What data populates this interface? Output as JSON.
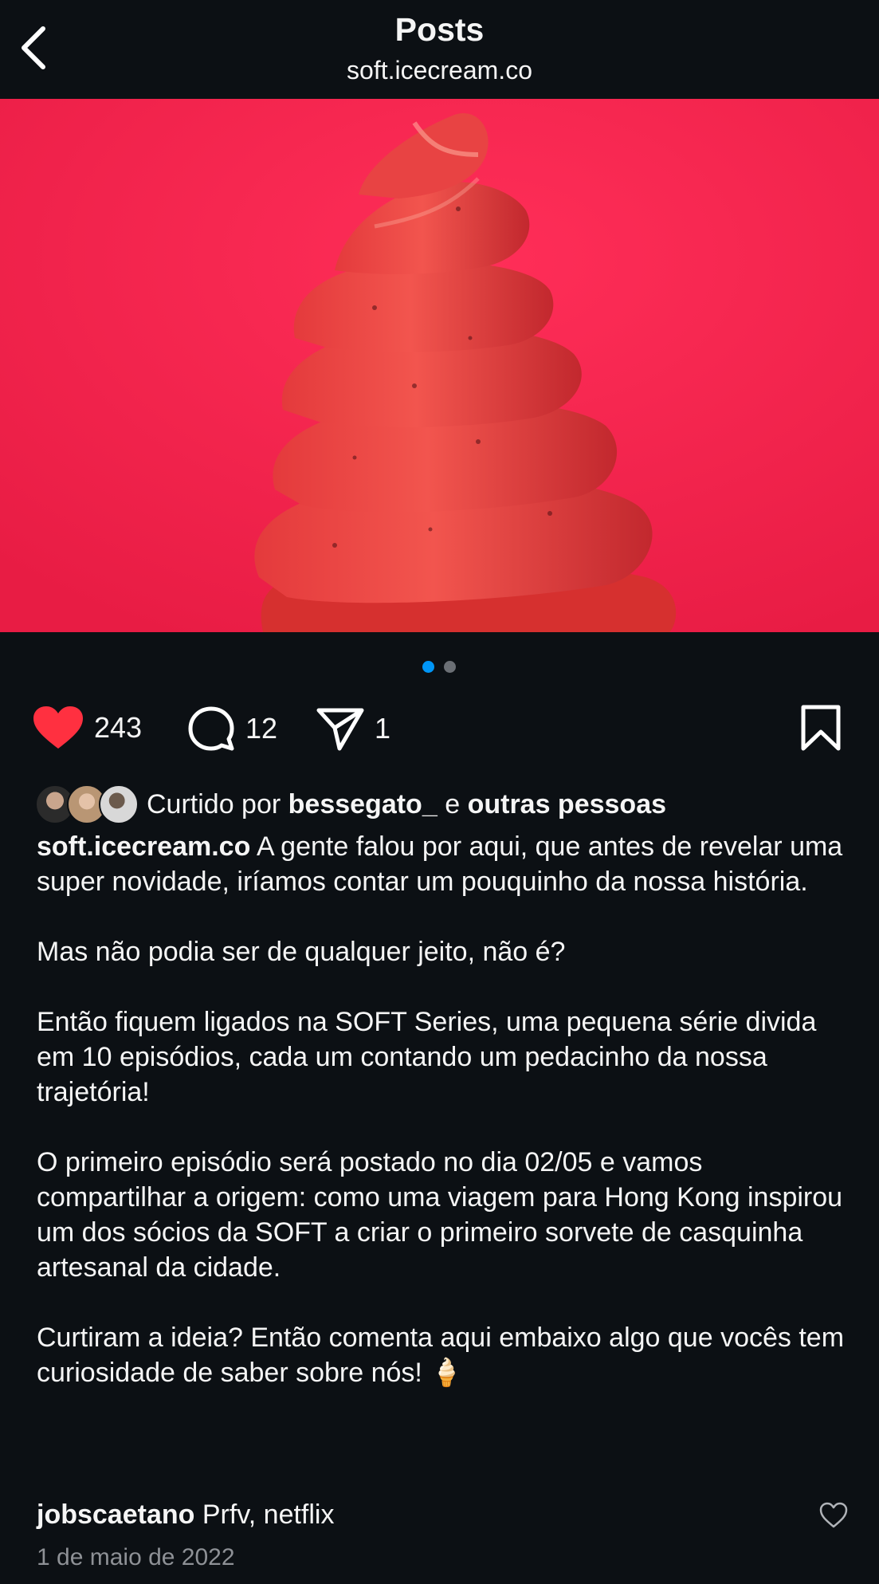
{
  "header": {
    "title": "Posts",
    "subtitle": "soft.icecream.co"
  },
  "post": {
    "photo_alt": "strawberry soft-serve ice cream swirl",
    "carousel": {
      "count": 2,
      "active": 1
    },
    "likes_count": "243",
    "comments_count": "12",
    "shares_count": "1",
    "liked_by": {
      "prefix": "Curtido por",
      "user": "bessegato_",
      "connector": "e",
      "others": "outras pessoas"
    },
    "caption": {
      "username": "soft.icecream.co",
      "first": "A gente falou por aqui, que antes de revelar uma super novidade, iríamos contar um pouquinho da nossa história.",
      "p2": "Mas não podia ser de qualquer jeito, não é?",
      "p3": "Então fiquem ligados na SOFT Series, uma pequena série divida em 10 episódios, cada um contando um pedacinho da nossa trajetória!",
      "p4": "O primeiro episódio será postado no dia 02/05 e vamos compartilhar a origem: como uma viagem para Hong Kong inspirou um dos sócios da SOFT a criar o primeiro sorvete de casquinha artesanal da cidade.",
      "p5": "Curtiram a ideia? Então comenta aqui embaixo algo que vocês tem curiosidade de saber sobre nós! 🍦"
    },
    "top_comment": {
      "username": "jobscaetano",
      "text": "Prfv, netflix"
    },
    "date": "1 de maio de 2022"
  },
  "colors": {
    "background": "#0c1014",
    "like_red": "#ff3040",
    "accent_blue": "#0095f6",
    "photo_bg": "#f0264c"
  },
  "icons": [
    "back-icon",
    "heart-icon",
    "comment-icon",
    "share-icon",
    "bookmark-icon",
    "small-heart-icon"
  ]
}
